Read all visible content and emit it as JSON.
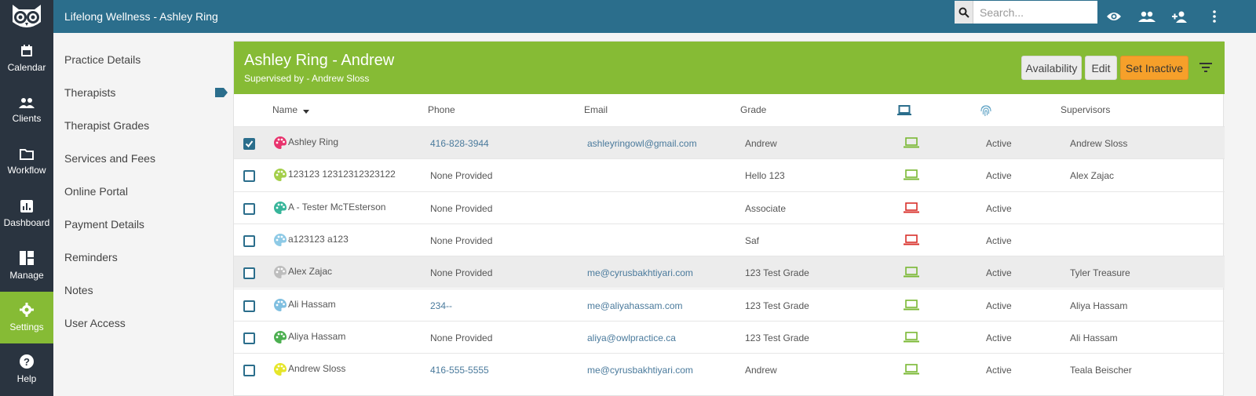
{
  "app": {
    "title": "Lifelong Wellness - Ashley Ring"
  },
  "search": {
    "placeholder": "Search..."
  },
  "topbar_icons": [
    "eye-icon",
    "group-icon",
    "add-person-icon",
    "more-vert-icon"
  ],
  "sidebar": {
    "items": [
      {
        "label": "Calendar",
        "icon": "calendar-icon"
      },
      {
        "label": "Clients",
        "icon": "people-icon"
      },
      {
        "label": "Workflow",
        "icon": "folder-icon"
      },
      {
        "label": "Dashboard",
        "icon": "bar-chart-icon"
      },
      {
        "label": "Manage",
        "icon": "dashboard-tiles-icon"
      },
      {
        "label": "Settings",
        "icon": "gear-icon",
        "active": true
      },
      {
        "label": "Help",
        "icon": "help-icon"
      }
    ]
  },
  "subnav": {
    "items": [
      "Practice Details",
      "Therapists",
      "Therapist Grades",
      "Services and Fees",
      "Online Portal",
      "Payment Details",
      "Reminders",
      "Notes",
      "User Access"
    ]
  },
  "panel": {
    "title": "Ashley Ring - Andrew",
    "subtitle": "Supervised by - Andrew Sloss",
    "buttons": {
      "availability": "Availability",
      "edit": "Edit",
      "set_inactive": "Set Inactive"
    }
  },
  "table": {
    "headers": {
      "name": "Name",
      "phone": "Phone",
      "email": "Email",
      "grade": "Grade",
      "supervisors": "Supervisors"
    },
    "rows": [
      {
        "checked": true,
        "name": "Ashley Ring",
        "palette_color": "#e8336d",
        "phone": "416-828-3944",
        "phone_link": true,
        "email": "ashleyringowl@gmail.com",
        "grade": "Andrew",
        "device": "green",
        "status": "Active",
        "supervisors": "Andrew Sloss",
        "highlight": true
      },
      {
        "checked": false,
        "name": "123123 12312312323122",
        "palette_color": "#a4cf4a",
        "phone": "None Provided",
        "phone_link": false,
        "email": "",
        "grade": "Hello 123",
        "device": "green",
        "status": "Active",
        "supervisors": "Alex Zajac",
        "highlight": false
      },
      {
        "checked": false,
        "name": "A - Tester McTEsterson",
        "palette_color": "#37b59a",
        "phone": "None Provided",
        "phone_link": false,
        "email": "",
        "grade": "Associate",
        "device": "red",
        "status": "Active",
        "supervisors": "",
        "highlight": false
      },
      {
        "checked": false,
        "name": "a123123 a123",
        "palette_color": "#8ecae6",
        "phone": "None Provided",
        "phone_link": false,
        "email": "",
        "grade": "Saf",
        "device": "red",
        "status": "Active",
        "supervisors": "",
        "highlight": false
      },
      {
        "checked": false,
        "name": "Alex Zajac",
        "palette_color": "#bdbdbd",
        "phone": "None Provided",
        "phone_link": false,
        "email": "me@cyrusbakhtiyari.com",
        "grade": "123 Test Grade",
        "device": "green",
        "status": "Active",
        "supervisors": "Tyler Treasure",
        "highlight": true
      },
      {
        "checked": false,
        "name": "Ali Hassam",
        "palette_color": "#7fbfe0",
        "phone": "234--",
        "phone_link": true,
        "email": "me@aliyahassam.com",
        "grade": "123 Test Grade",
        "device": "green",
        "status": "Active",
        "supervisors": "Aliya Hassam",
        "highlight": false
      },
      {
        "checked": false,
        "name": "Aliya Hassam",
        "palette_color": "#4caf50",
        "phone": "None Provided",
        "phone_link": false,
        "email": "aliya@owlpractice.ca",
        "grade": "123 Test Grade",
        "device": "green",
        "status": "Active",
        "supervisors": "Ali Hassam",
        "highlight": false
      },
      {
        "checked": false,
        "name": "Andrew Sloss",
        "palette_color": "#e6e62a",
        "phone": "416-555-5555",
        "phone_link": true,
        "email": "me@cyrusbakhtiyari.com",
        "grade": "Andrew",
        "device": "green",
        "status": "Active",
        "supervisors": "Teala Beischer",
        "highlight": false
      }
    ]
  },
  "colors": {
    "topbar": "#2b6e8c",
    "sidebar": "#2a3440",
    "accent_green": "#86bb35",
    "orange": "#f6a02a",
    "device_green": "#7ab833",
    "device_red": "#d9302b",
    "link_blue": "#4a7a9c"
  }
}
